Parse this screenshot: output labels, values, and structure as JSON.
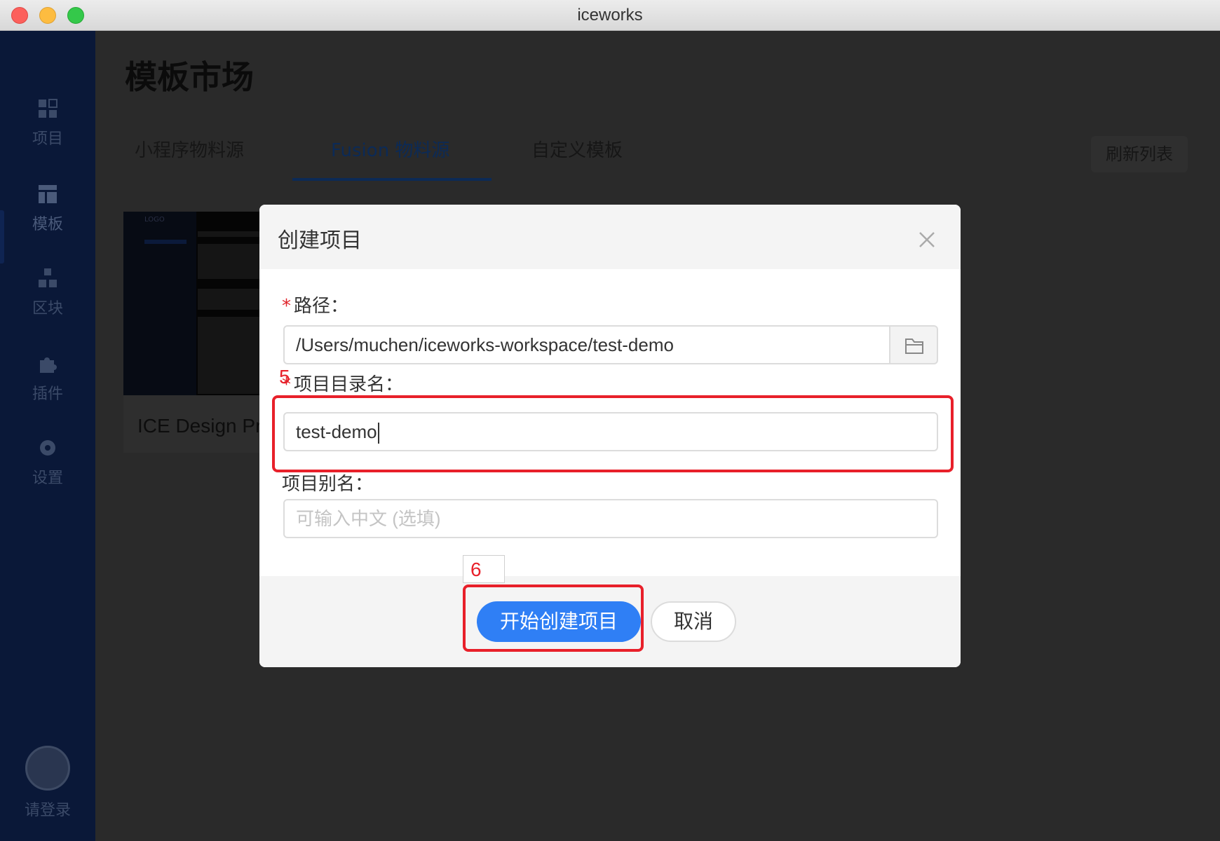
{
  "window": {
    "title": "iceworks"
  },
  "sidebar": {
    "items": [
      {
        "label": "项目",
        "icon": "grid-icon"
      },
      {
        "label": "模板",
        "icon": "layout-icon"
      },
      {
        "label": "区块",
        "icon": "blocks-icon"
      },
      {
        "label": "插件",
        "icon": "puzzle-icon"
      },
      {
        "label": "设置",
        "icon": "gear-icon"
      }
    ],
    "active_index": 1,
    "login_label": "请登录"
  },
  "main": {
    "title": "模板市场",
    "tabs": [
      {
        "label": "小程序物料源"
      },
      {
        "label": "Fusion 物料源"
      },
      {
        "label": "自定义模板"
      }
    ],
    "active_tab": 1,
    "refresh_label": "刷新列表",
    "card": {
      "name": "ICE Design Pro",
      "thumb_logo": "LOGO"
    }
  },
  "modal": {
    "title": "创建项目",
    "fields": {
      "path": {
        "label": "路径：",
        "required": true,
        "value": "/Users/muchen/iceworks-workspace/test-demo"
      },
      "dirname": {
        "label": "项目目录名：",
        "required": true,
        "value": "test-demo"
      },
      "alias": {
        "label": "项目别名：",
        "required": false,
        "value": "",
        "placeholder": "可输入中文 (选填)"
      }
    },
    "buttons": {
      "submit": "开始创建项目",
      "cancel": "取消"
    }
  },
  "annotations": {
    "step5": "5",
    "step6": "6"
  },
  "colors": {
    "primary": "#2f7ff5",
    "annotation": "#e8202a",
    "sidebar": "#0a1838"
  }
}
